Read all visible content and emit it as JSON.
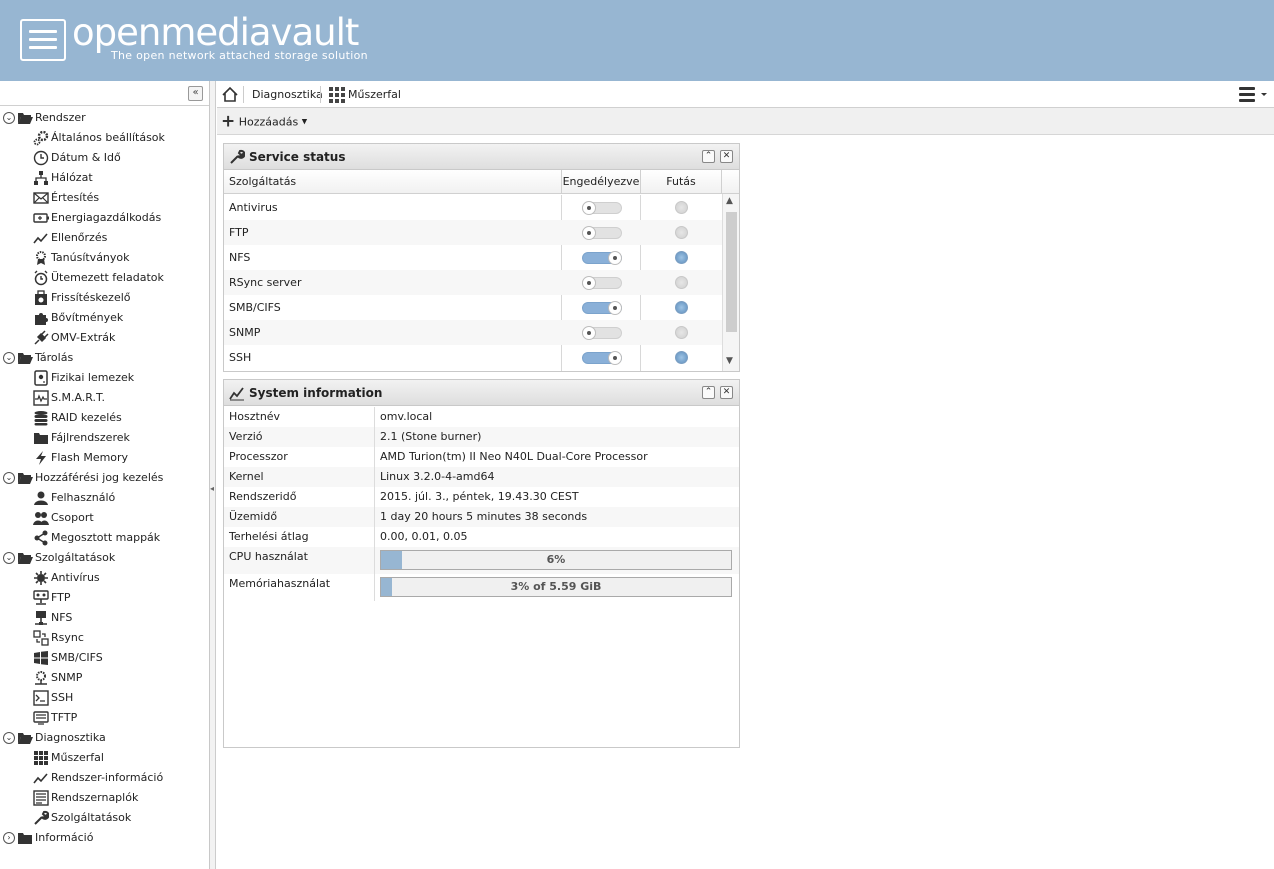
{
  "app": {
    "name": "openmediavault",
    "tagline": "The open network attached storage solution"
  },
  "nav": [
    {
      "label": "Rendszer",
      "type": "group",
      "expanded": true,
      "icon": "folder-open-icon"
    },
    {
      "label": "Általános beállítások",
      "type": "item",
      "icon": "gears-icon"
    },
    {
      "label": "Dátum & Idő",
      "type": "item",
      "icon": "clock-icon"
    },
    {
      "label": "Hálózat",
      "type": "item",
      "icon": "network-icon"
    },
    {
      "label": "Értesítés",
      "type": "item",
      "icon": "envelope-icon"
    },
    {
      "label": "Energiagazdálkodás",
      "type": "item",
      "icon": "battery-icon"
    },
    {
      "label": "Ellenőrzés",
      "type": "item",
      "icon": "line-chart-icon"
    },
    {
      "label": "Tanúsítványok",
      "type": "item",
      "icon": "certificate-icon"
    },
    {
      "label": "Ütemezett feladatok",
      "type": "item",
      "icon": "alarm-clock-icon"
    },
    {
      "label": "Frissítéskezelő",
      "type": "item",
      "icon": "update-icon"
    },
    {
      "label": "Bővítmények",
      "type": "item",
      "icon": "puzzle-icon"
    },
    {
      "label": "OMV-Extrák",
      "type": "item",
      "icon": "plug-icon"
    },
    {
      "label": "Tárolás",
      "type": "group",
      "expanded": true,
      "icon": "folder-open-icon"
    },
    {
      "label": "Fizikai lemezek",
      "type": "item",
      "icon": "hdd-icon"
    },
    {
      "label": "S.M.A.R.T.",
      "type": "item",
      "icon": "heartbeat-icon"
    },
    {
      "label": "RAID kezelés",
      "type": "item",
      "icon": "database-icon"
    },
    {
      "label": "Fájlrendszerek",
      "type": "item",
      "icon": "folder-icon"
    },
    {
      "label": "Flash Memory",
      "type": "item",
      "icon": "flash-icon"
    },
    {
      "label": "Hozzáférési jog kezelés",
      "type": "group",
      "expanded": true,
      "icon": "folder-open-icon"
    },
    {
      "label": "Felhasználó",
      "type": "item",
      "icon": "user-icon"
    },
    {
      "label": "Csoport",
      "type": "item",
      "icon": "users-icon"
    },
    {
      "label": "Megosztott mappák",
      "type": "item",
      "icon": "share-icon"
    },
    {
      "label": "Szolgáltatások",
      "type": "group",
      "expanded": true,
      "icon": "folder-open-icon"
    },
    {
      "label": "Antivírus",
      "type": "item",
      "icon": "virus-icon"
    },
    {
      "label": "FTP",
      "type": "item",
      "icon": "ftp-icon"
    },
    {
      "label": "NFS",
      "type": "item",
      "icon": "nfs-icon"
    },
    {
      "label": "Rsync",
      "type": "item",
      "icon": "rsync-icon"
    },
    {
      "label": "SMB/CIFS",
      "type": "item",
      "icon": "windows-icon"
    },
    {
      "label": "SNMP",
      "type": "item",
      "icon": "snmp-icon"
    },
    {
      "label": "SSH",
      "type": "item",
      "icon": "terminal-icon"
    },
    {
      "label": "TFTP",
      "type": "item",
      "icon": "tftp-icon"
    },
    {
      "label": "Diagnosztika",
      "type": "group",
      "expanded": true,
      "icon": "folder-open-icon"
    },
    {
      "label": "Műszerfal",
      "type": "item",
      "icon": "dashboard-grid-icon"
    },
    {
      "label": "Rendszer-információ",
      "type": "item",
      "icon": "line-chart-icon"
    },
    {
      "label": "Rendszernaplók",
      "type": "item",
      "icon": "log-icon"
    },
    {
      "label": "Szolgáltatások",
      "type": "item",
      "icon": "wrench-icon"
    },
    {
      "label": "Információ",
      "type": "group",
      "expanded": false,
      "icon": "folder-icon"
    }
  ],
  "breadcrumb": {
    "section": "Diagnosztika",
    "page": "Műszerfal"
  },
  "toolbar": {
    "add_label": "Hozzáadás"
  },
  "service_status": {
    "title": "Service status",
    "columns": {
      "service": "Szolgáltatás",
      "enabled": "Engedélyezve",
      "running": "Futás"
    },
    "rows": [
      {
        "name": "Antivirus",
        "enabled": false,
        "running": false
      },
      {
        "name": "FTP",
        "enabled": false,
        "running": false
      },
      {
        "name": "NFS",
        "enabled": true,
        "running": true
      },
      {
        "name": "RSync server",
        "enabled": false,
        "running": false
      },
      {
        "name": "SMB/CIFS",
        "enabled": true,
        "running": true
      },
      {
        "name": "SNMP",
        "enabled": false,
        "running": false
      },
      {
        "name": "SSH",
        "enabled": true,
        "running": true
      }
    ]
  },
  "system_info": {
    "title": "System information",
    "rows": [
      {
        "key": "Hosztnév",
        "value": "omv.local"
      },
      {
        "key": "Verzió",
        "value": "2.1 (Stone burner)"
      },
      {
        "key": "Processzor",
        "value": "AMD Turion(tm) II Neo N40L Dual-Core Processor"
      },
      {
        "key": "Kernel",
        "value": "Linux 3.2.0-4-amd64"
      },
      {
        "key": "Rendszeridő",
        "value": "2015. júl. 3., péntek, 19.43.30 CEST"
      },
      {
        "key": "Üzemidő",
        "value": "1 day 20 hours 5 minutes 38 seconds"
      },
      {
        "key": "Terhelési átlag",
        "value": "0.00, 0.01, 0.05"
      }
    ],
    "cpu": {
      "key": "CPU használat",
      "label": "6%",
      "fraction": 0.06
    },
    "memory": {
      "key": "Memóriahasználat",
      "label": "3% of 5.59 GiB",
      "fraction": 0.03
    }
  },
  "colors": {
    "header_bg": "#97b6d2",
    "switch_on": "#8ab0d8",
    "led_on": "#5f8fbd"
  }
}
